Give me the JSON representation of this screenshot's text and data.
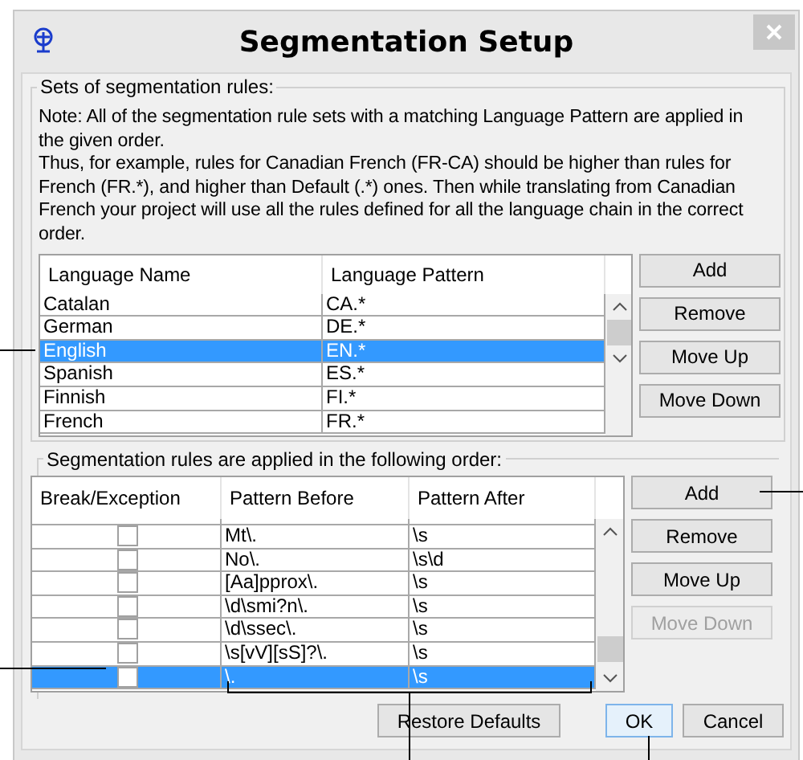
{
  "window": {
    "title": "Segmentation Setup"
  },
  "rule_sets": {
    "label": "Sets of segmentation rules:",
    "note": [
      "Note: All of the segmentation rule sets with a matching Language Pattern are applied in the given order.",
      "Thus, for example, rules for Canadian French (FR-CA) should be higher than rules for French (FR.*), and higher than Default (.*) ones. Then while translating from Canadian French your project will use all the rules defined for all the language chain in the correct order."
    ],
    "columns": [
      "Language Name",
      "Language Pattern"
    ],
    "rows": [
      {
        "name": "Catalan",
        "pattern": "CA.*",
        "selected": false
      },
      {
        "name": "German",
        "pattern": "DE.*",
        "selected": false
      },
      {
        "name": "English",
        "pattern": "EN.*",
        "selected": true
      },
      {
        "name": "Spanish",
        "pattern": "ES.*",
        "selected": false
      },
      {
        "name": "Finnish",
        "pattern": "FI.*",
        "selected": false
      },
      {
        "name": "French",
        "pattern": "FR.*",
        "selected": false
      }
    ],
    "buttons": [
      {
        "label": "Add",
        "disabled": false
      },
      {
        "label": "Remove",
        "disabled": false
      },
      {
        "label": "Move Up",
        "disabled": false
      },
      {
        "label": "Move Down",
        "disabled": false
      }
    ]
  },
  "rules": {
    "label": "Segmentation rules are applied in the following order:",
    "columns": [
      "Break/Exception",
      "Pattern Before",
      "Pattern After"
    ],
    "rows": [
      {
        "checked": false,
        "before": "Mt\\.",
        "after": "\\s",
        "selected": false
      },
      {
        "checked": false,
        "before": "No\\.",
        "after": "\\s\\d",
        "selected": false
      },
      {
        "checked": false,
        "before": "[Aa]pprox\\.",
        "after": "\\s",
        "selected": false
      },
      {
        "checked": false,
        "before": "\\d\\smi?n\\.",
        "after": "\\s",
        "selected": false
      },
      {
        "checked": false,
        "before": "\\d\\ssec\\.",
        "after": "\\s",
        "selected": false
      },
      {
        "checked": false,
        "before": "\\s[vV][sS]?\\.",
        "after": "\\s",
        "selected": false
      },
      {
        "checked": false,
        "before": "\\.",
        "after": "\\s",
        "selected": true
      }
    ],
    "buttons": [
      {
        "label": "Add",
        "disabled": false
      },
      {
        "label": "Remove",
        "disabled": false
      },
      {
        "label": "Move Up",
        "disabled": false
      },
      {
        "label": "Move Down",
        "disabled": true
      }
    ]
  },
  "footer_buttons": [
    {
      "label": "Restore Defaults",
      "kind": "normal"
    },
    {
      "label": "OK",
      "kind": "default"
    },
    {
      "label": "Cancel",
      "kind": "normal"
    }
  ]
}
